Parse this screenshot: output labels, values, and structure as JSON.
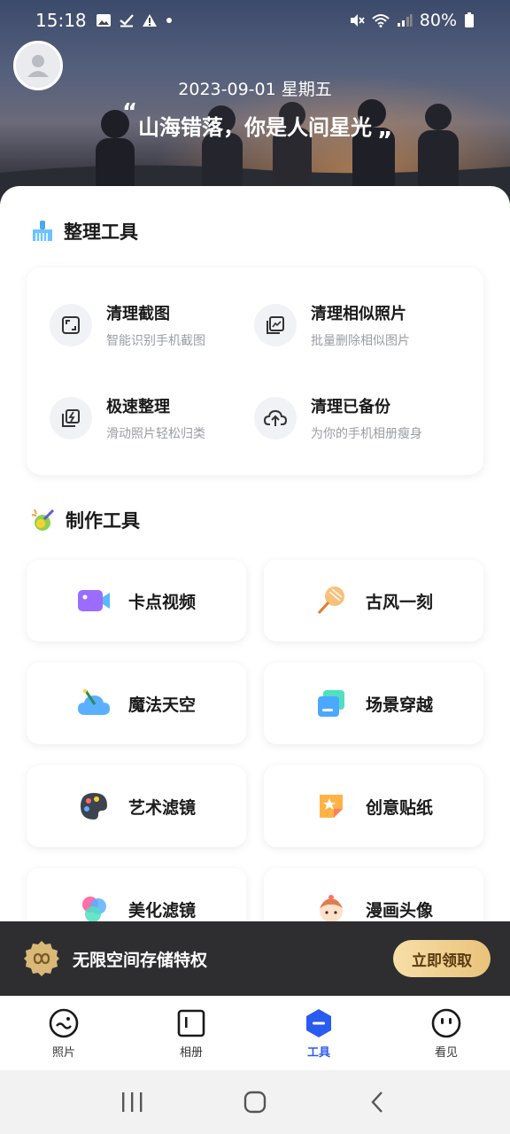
{
  "status_bar": {
    "time": "15:18",
    "battery": "80%",
    "icons": [
      "photo-icon",
      "check-icon",
      "warning-icon",
      "dot-icon",
      "mute-icon",
      "wifi-icon",
      "signal-icon",
      "battery-icon"
    ]
  },
  "header": {
    "date": "2023-09-01 星期五",
    "quote": "山海错落，你是人间星光"
  },
  "organize": {
    "title": "整理工具",
    "items": [
      {
        "title": "清理截图",
        "subtitle": "智能识别手机截图",
        "icon": "screenshot-icon"
      },
      {
        "title": "清理相似照片",
        "subtitle": "批量删除相似图片",
        "icon": "similar-photo-icon"
      },
      {
        "title": "极速整理",
        "subtitle": "滑动照片轻松归类",
        "icon": "fast-sort-icon"
      },
      {
        "title": "清理已备份",
        "subtitle": "为你的手机相册瘦身",
        "icon": "cloud-upload-icon"
      }
    ]
  },
  "create": {
    "title": "制作工具",
    "items": [
      {
        "label": "卡点视频",
        "icon": "video-icon"
      },
      {
        "label": "古风一刻",
        "icon": "fan-icon"
      },
      {
        "label": "魔法天空",
        "icon": "magic-sky-icon"
      },
      {
        "label": "场景穿越",
        "icon": "scene-icon"
      },
      {
        "label": "艺术滤镜",
        "icon": "palette-icon"
      },
      {
        "label": "创意贴纸",
        "icon": "sticker-icon"
      },
      {
        "label": "美化滤镜",
        "icon": "beauty-filter-icon"
      },
      {
        "label": "漫画头像",
        "icon": "cartoon-avatar-icon"
      }
    ]
  },
  "promo": {
    "text": "无限空间存储特权",
    "button": "立即领取"
  },
  "bottom_nav": {
    "items": [
      {
        "label": "照片",
        "icon": "smile-icon"
      },
      {
        "label": "相册",
        "icon": "album-icon"
      },
      {
        "label": "工具",
        "icon": "tools-icon"
      },
      {
        "label": "看见",
        "icon": "face-icon"
      }
    ],
    "active_index": 2
  },
  "colors": {
    "accent": "#2a5bf0",
    "promo_bg": "#2e2e30",
    "promo_button": "#e9c27a"
  }
}
